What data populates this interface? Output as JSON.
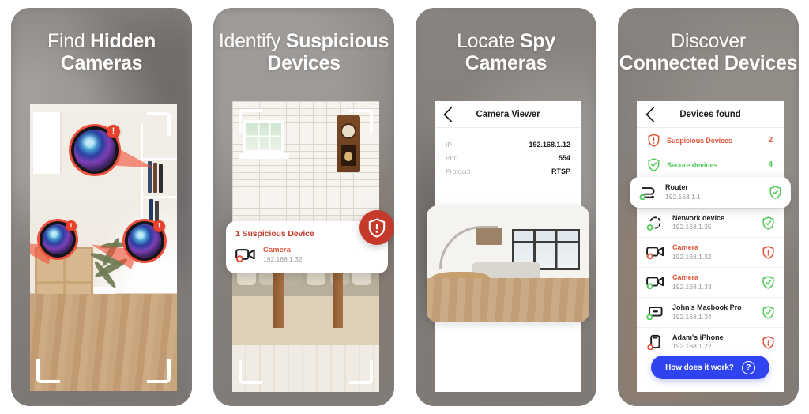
{
  "panels": [
    {
      "headline_line1_regular": "Find ",
      "headline_line1_strong": "Hidden",
      "headline_line2": "Cameras",
      "markers": [
        {
          "id": "camera-marker-1",
          "alert": "!"
        },
        {
          "id": "camera-marker-2",
          "alert": "!"
        },
        {
          "id": "camera-marker-3",
          "alert": "!"
        }
      ]
    },
    {
      "headline_line1_regular": "Identify ",
      "headline_line1_strong": "Suspicious",
      "headline_line2": "Devices",
      "card": {
        "title": "1 Suspicious Device",
        "device_name": "Camera",
        "device_ip": "192.168.1.32",
        "shield_glyph": "!"
      }
    },
    {
      "headline_line1_regular": "Locate ",
      "headline_line1_strong": "Spy",
      "headline_line2": "Cameras",
      "screen": {
        "title": "Camera Viewer",
        "rows": [
          {
            "key": "IP",
            "value": "192.168.1.12"
          },
          {
            "key": "Port",
            "value": "554"
          },
          {
            "key": "Protocol",
            "value": "RTSP"
          }
        ]
      }
    },
    {
      "headline_line1_regular": "Discover",
      "headline_line1_strong": "",
      "headline_line2": "Connected Devices",
      "screen": {
        "title": "Devices found",
        "summary": [
          {
            "label": "Suspicious Devices",
            "count": "2",
            "state": "alert"
          },
          {
            "label": "Secure devices",
            "count": "4",
            "state": "secure"
          }
        ],
        "devices": [
          {
            "name": "Router",
            "ip": "192.168.1.1",
            "icon": "router-icon",
            "name_state": "normal",
            "status": "secure",
            "highlighted": true
          },
          {
            "name": "Network device",
            "ip": "192.168.1.35",
            "icon": "network-icon",
            "name_state": "normal",
            "status": "secure",
            "highlighted": false
          },
          {
            "name": "Camera",
            "ip": "192.168.1.32",
            "icon": "camera-icon",
            "name_state": "alert",
            "status": "alert",
            "highlighted": false
          },
          {
            "name": "Camera",
            "ip": "192.168.1.33",
            "icon": "camera-icon",
            "name_state": "alert",
            "status": "secure",
            "highlighted": false
          },
          {
            "name": "John's Macbook Pro",
            "ip": "192.168.1.34",
            "icon": "laptop-icon",
            "name_state": "normal",
            "status": "secure",
            "highlighted": false
          },
          {
            "name": "Adam's iPhone",
            "ip": "192.168.1.22",
            "icon": "phone-icon",
            "name_state": "normal",
            "status": "alert",
            "highlighted": false
          }
        ],
        "cta_label": "How does it work?",
        "cta_icon_glyph": "?"
      }
    }
  ],
  "colors": {
    "alert_red": "#e0563c",
    "shield_red": "#c4392a",
    "secure_green": "#53c95a",
    "cta_blue": "#2f43f0",
    "headline_white": "#ffffff",
    "card_backdrop": "#8a8785"
  }
}
